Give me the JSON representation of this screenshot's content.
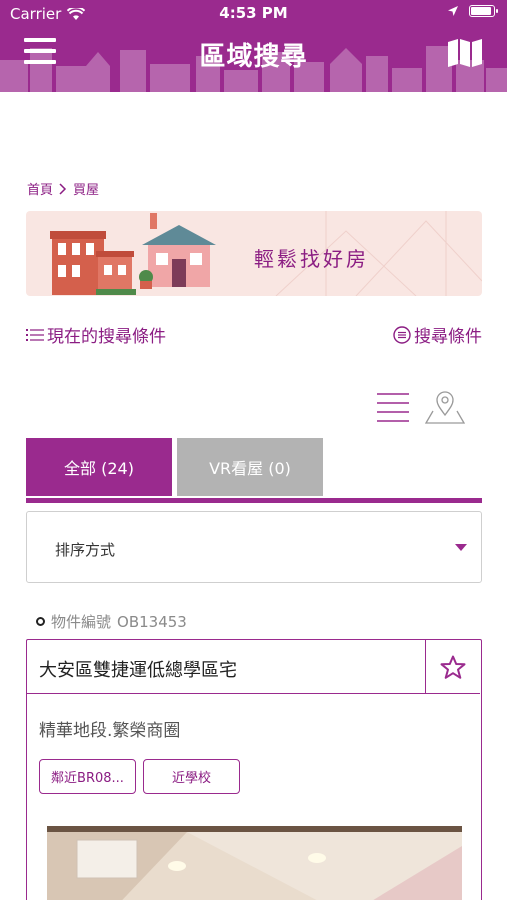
{
  "status_bar": {
    "carrier": "Carrier",
    "time": "4:53 PM"
  },
  "header": {
    "title": "區域搜尋",
    "background_color": "#9a2a8e",
    "menu_icon": "hamburger-icon",
    "map_icon": "map-icon"
  },
  "breadcrumb": {
    "items": [
      "首頁",
      "買屋"
    ]
  },
  "banner": {
    "text": "輕鬆找好房"
  },
  "criteria": {
    "current_label": "現在的搜尋條件",
    "search_label": "搜尋條件"
  },
  "view_toggle": {
    "list_icon": "list-view-icon",
    "map_icon": "map-pin-icon"
  },
  "tabs": [
    {
      "label": "全部 (24)",
      "active": true
    },
    {
      "label": "VR看屋 (0)",
      "active": false
    }
  ],
  "sort": {
    "label": "排序方式"
  },
  "listing": {
    "id_label": "物件編號",
    "id_value": "OB13453",
    "title": "大安區雙捷運低總學區宅",
    "subtitle": "精華地段.繁榮商圈",
    "tags": [
      "鄰近BR08...",
      "近學校"
    ],
    "favorite_icon": "star-outline-icon"
  },
  "colors": {
    "accent": "#9a2a8e",
    "tab_inactive": "#b3b3b3"
  }
}
